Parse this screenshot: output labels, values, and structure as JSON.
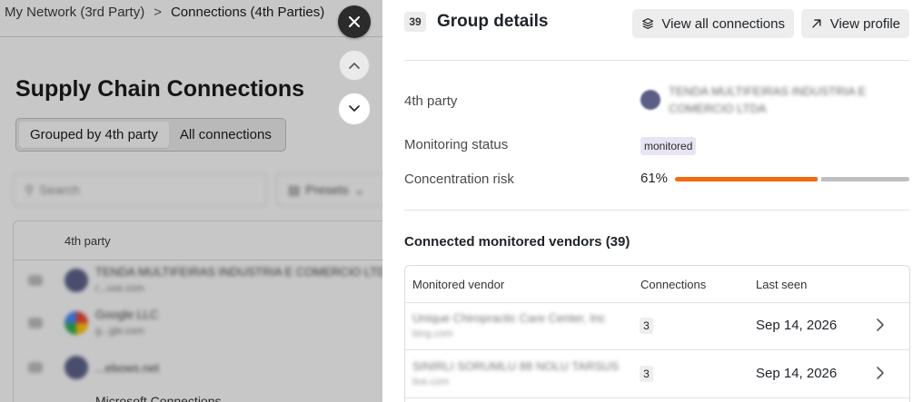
{
  "breadcrumb": {
    "parent": "My Network (3rd Party)",
    "current": "Connections (4th Parties)"
  },
  "background": {
    "page_title": "Supply Chain Connections",
    "view_toggle": [
      "Grouped by 4th party",
      "All connections"
    ],
    "search_placeholder": "Search",
    "presets_label": "Presets",
    "table_header": "4th party",
    "rows": [
      {
        "name": "TENDA MULTIFEIRAS INDUSTRIA E COMERCIO LTDA",
        "domain": "r...uve.com"
      },
      {
        "name": "Google LLC",
        "domain": "g...gle.com"
      },
      {
        "name": "",
        "domain": "...ebows.net"
      }
    ],
    "more_text": "Microsoft Connections"
  },
  "drawer": {
    "count": "39",
    "title": "Group details",
    "view_all_label": "View all connections",
    "view_profile_label": "View profile",
    "fields": {
      "fourth_party_label": "4th party",
      "fourth_party_value": "TENDA MULTIFEIRAS INDUSTRIA E COMERCIO LTDA",
      "monitoring_label": "Monitoring status",
      "monitoring_value": "monitored",
      "risk_label": "Concentration risk",
      "risk_value": "61%",
      "risk_fraction": 0.61
    },
    "section_title": "Connected monitored vendors (39)",
    "columns": [
      "Monitored vendor",
      "Connections",
      "Last seen"
    ],
    "vendors": [
      {
        "name": "Unique Chiropractic Care Center, Inc",
        "domain": "bing.com",
        "connections": "3",
        "last_seen": "Sep 14, 2026"
      },
      {
        "name": "SINIRLI SORUMLU 88 NOLU TARSUS",
        "domain": "live.com",
        "connections": "3",
        "last_seen": "Sep 14, 2026"
      }
    ]
  },
  "colors": {
    "accent_bar": "#f26a0f",
    "pill_bg": "#e8e4f4",
    "close_button": "#2b2b2b"
  },
  "icons": [
    "close-icon",
    "chevron-up-icon",
    "chevron-down-icon",
    "layers-icon",
    "arrow-up-right-icon",
    "chevron-right-icon",
    "search-icon",
    "presets-icon"
  ]
}
